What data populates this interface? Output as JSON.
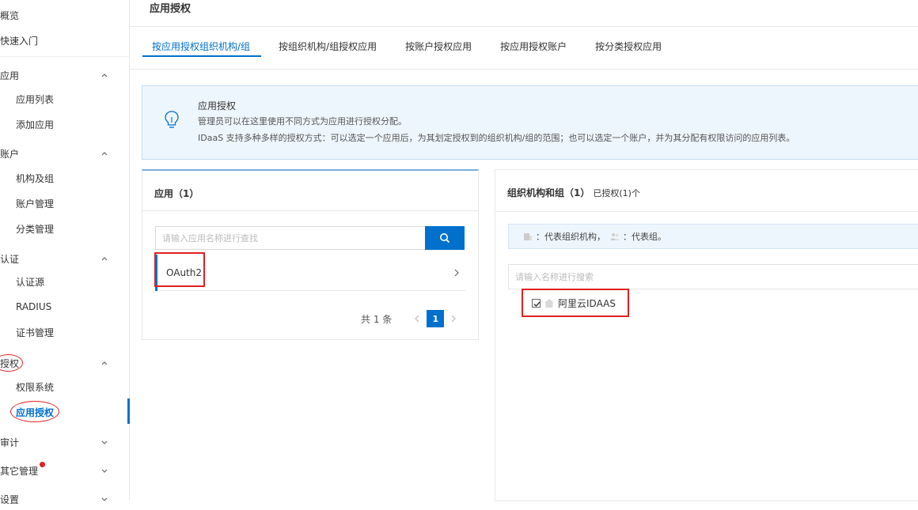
{
  "sidebar": {
    "overview": "概览",
    "quickstart": "快速入门",
    "app_group": {
      "label": "应用",
      "items": [
        "应用列表",
        "添加应用"
      ]
    },
    "account_group": {
      "label": "账户",
      "items": [
        "机构及组",
        "账户管理",
        "分类管理"
      ]
    },
    "auth_group": {
      "label": "认证",
      "items": [
        "认证源",
        "RADIUS",
        "证书管理"
      ]
    },
    "authz_group": {
      "label": "授权",
      "items": [
        "权限系统",
        "应用授权"
      ]
    },
    "audit": "审计",
    "other": "其它管理",
    "settings": "设置"
  },
  "header": {
    "title": "应用授权"
  },
  "tabs": [
    "按应用授权组织机构/组",
    "按组织机构/组授权应用",
    "按账户授权应用",
    "按应用授权账户",
    "按分类授权应用"
  ],
  "notice": {
    "title": "应用授权",
    "line1": "管理员可以在这里使用不同方式为应用进行授权分配。",
    "line2": "IDaaS 支持多种多样的授权方式：可以选定一个应用后，为其划定授权到的组织机构/组的范围；也可以选定一个账户，并为其分配有权限访问的应用列表。"
  },
  "app_panel": {
    "title": "应用（1）",
    "search_placeholder": "请输入应用名称进行查找",
    "apps": [
      "OAuth2"
    ],
    "pager": {
      "total": "共 1 条",
      "current": "1"
    }
  },
  "org_panel": {
    "title": "组织机构和组（1）",
    "authorized": "已授权(1)个",
    "legend_org": "：代表组织机构，",
    "legend_group": "：代表组。",
    "search_placeholder": "请输入名称进行搜索",
    "node": "阿里云IDAAS"
  },
  "colors": {
    "accent": "#0070cc",
    "annotation_red": "#e02020",
    "notice_bg": "#eef6fd"
  }
}
